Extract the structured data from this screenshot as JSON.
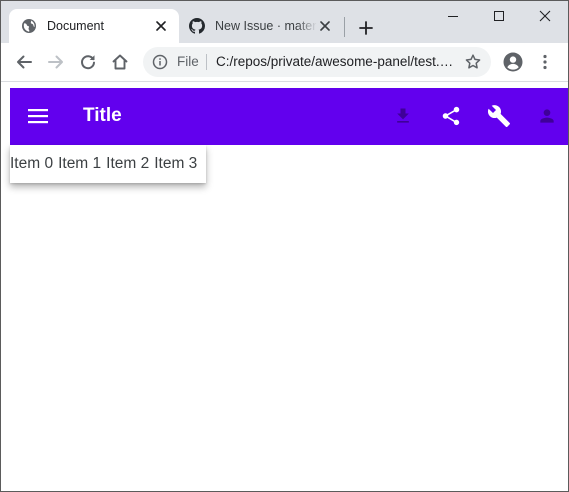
{
  "browser": {
    "tabs": [
      {
        "title": "Document",
        "active": true,
        "icon": "globe-icon"
      },
      {
        "title": "New Issue · material-components/material-components-web",
        "active": false,
        "icon": "github-icon"
      }
    ],
    "window_controls": [
      "minimize-icon",
      "maximize-icon",
      "close-icon"
    ],
    "address": {
      "security_label": "File",
      "url": "C:/repos/private/awesome-panel/test.html"
    }
  },
  "app": {
    "title": "Title",
    "bar_color": "#6200ee",
    "actions": [
      "file-download-icon",
      "share-icon",
      "build-icon",
      "person-icon"
    ],
    "menu_items": [
      {
        "label": "Item 0"
      },
      {
        "label": "Item 1"
      },
      {
        "label": "Item 2"
      },
      {
        "label": "Item 3"
      }
    ]
  }
}
